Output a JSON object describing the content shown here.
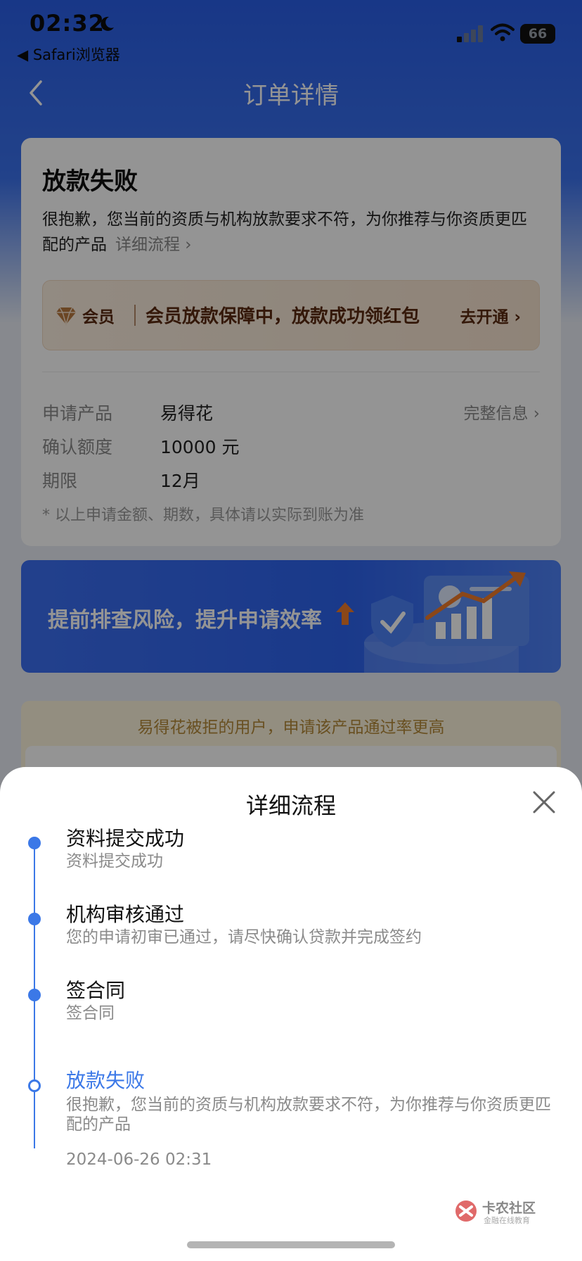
{
  "status_bar": {
    "time": "02:32",
    "back_app": "◀ Safari浏览器",
    "battery": "66"
  },
  "nav": {
    "title": "订单详情"
  },
  "status_card": {
    "title": "放款失败",
    "desc": "很抱歉，您当前的资质与机构放款要求不符，为你推荐与你资质更匹配的产品",
    "detail_link": "详细流程 ›",
    "vip": {
      "badge": "会员",
      "text": "会员放款保障中，放款成功领红包",
      "action": "去开通 ›"
    },
    "info": [
      {
        "key": "申请产品",
        "value": "易得花",
        "link": "完整信息 ›"
      },
      {
        "key": "确认额度",
        "value": "10000 元"
      },
      {
        "key": "期限",
        "value": "12月"
      }
    ],
    "note": "* 以上申请金额、期数，具体请以实际到账为准"
  },
  "banner": {
    "text": "提前排查风险，提升申请效率"
  },
  "recommend": {
    "text": "易得花被拒的用户，申请该产品通过率更高"
  },
  "sheet": {
    "title": "详细流程",
    "steps": [
      {
        "title": "资料提交成功",
        "desc": "资料提交成功"
      },
      {
        "title": "机构审核通过",
        "desc": "您的申请初审已通过，请尽快确认贷款并完成签约"
      },
      {
        "title": "签合同",
        "desc": "签合同"
      },
      {
        "title": "放款失败",
        "desc": "很抱歉，您当前的资质与机构放款要求不符，为你推荐与你资质更匹配的产品",
        "time": "2024-06-26 02:31"
      }
    ]
  },
  "watermark": {
    "name": "卡农社区",
    "sub": "金融在线教育"
  },
  "colors": {
    "accent": "#3b78e7",
    "header_blue": "#2a5fe8",
    "vip_brown": "#5a2a10"
  },
  "icons": [
    "moon-icon",
    "signal-icon",
    "wifi-icon",
    "back-icon",
    "diamond-icon",
    "close-icon",
    "up-arrow-icon",
    "shield-chart-illustration"
  ]
}
